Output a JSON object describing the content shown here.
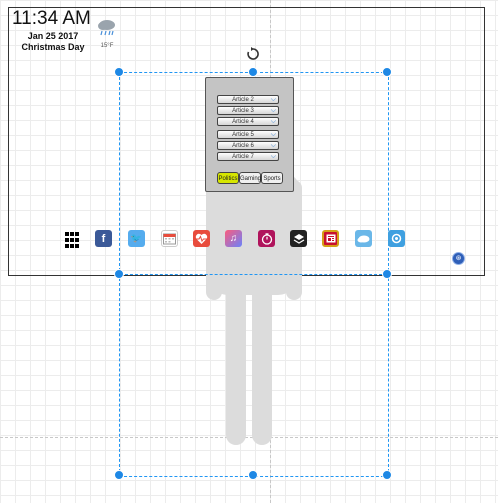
{
  "clock": {
    "time": "11:34 AM",
    "date": "Jan 25 2017",
    "event": "Christmas Day"
  },
  "weather": {
    "icon": "rain-cloud-icon",
    "temp": "15°F"
  },
  "phone": {
    "articles": [
      "Article 2",
      "Article 3",
      "Article 4",
      "Article 5",
      "Article 6",
      "Article 7"
    ],
    "tabs": [
      "Politics",
      "Gaming",
      "Sports"
    ],
    "active_tab": "Politics"
  },
  "dock": [
    "apps-grid-icon",
    "facebook-icon",
    "twitter-icon",
    "calendar-icon",
    "health-icon",
    "music-icon",
    "timer-icon",
    "layers-icon",
    "news-icon",
    "weather-icon",
    "settings-icon"
  ],
  "colors": {
    "selection": "#2196f3",
    "active_tab": "#d6e600"
  }
}
